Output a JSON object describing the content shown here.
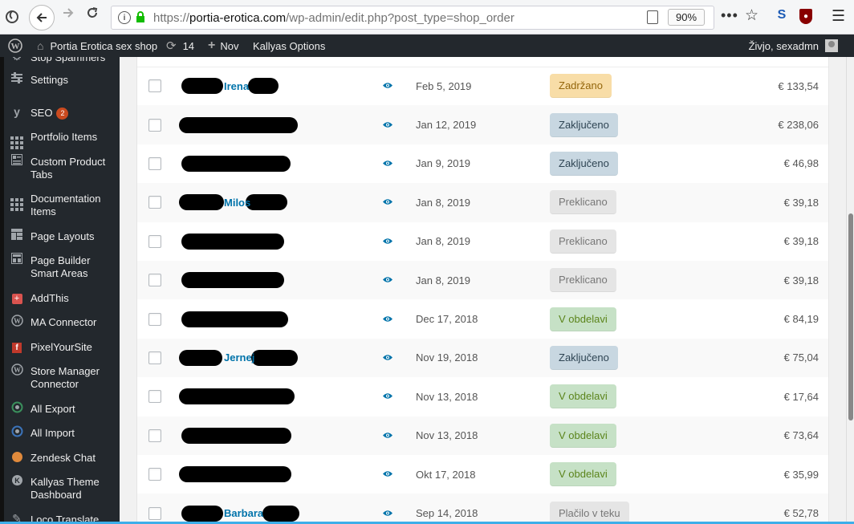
{
  "browser": {
    "url_scheme": "https://",
    "url_host": "portia-erotica.com",
    "url_path": "/wp-admin/edit.php?post_type=shop_order",
    "zoom": "90%",
    "icons": [
      "firefox-icon",
      "back-arrow-icon",
      "forward-arrow-icon",
      "reload-icon",
      "info-icon",
      "lock-icon",
      "reader-view-icon",
      "more-actions-icon",
      "bookmark-star-icon",
      "extension-s-icon",
      "ublock-icon",
      "hamburger-menu-icon"
    ]
  },
  "admin_bar": {
    "site_name": "Portia Erotica sex shop",
    "updates_count": "14",
    "new_label": "Nov",
    "theme_options": "Kallyas Options",
    "greeting": "Živjo, sexadmn"
  },
  "sidebar": {
    "partial_top_item": "Stop Spammers",
    "items": [
      {
        "label": "Settings",
        "icon": "sliders-icon"
      },
      {
        "label": "SEO",
        "icon": "yoast-icon",
        "badge": "2"
      },
      {
        "label": "Portfolio Items",
        "icon": "grid-icon"
      },
      {
        "label": "Custom Product Tabs",
        "icon": "tabs-icon"
      },
      {
        "label": "Documentation Items",
        "icon": "grid-icon"
      },
      {
        "label": "Page Layouts",
        "icon": "layout-icon"
      },
      {
        "label": "Page Builder Smart Areas",
        "icon": "builder-icon"
      },
      {
        "label": "AddThis",
        "icon": "addthis-icon"
      },
      {
        "label": "MA Connector",
        "icon": "wordpress-icon"
      },
      {
        "label": "PixelYourSite",
        "icon": "facebook-icon"
      },
      {
        "label": "Store Manager Connector",
        "icon": "wordpress-icon"
      },
      {
        "label": "All Export",
        "icon": "export-icon"
      },
      {
        "label": "All Import",
        "icon": "import-icon"
      },
      {
        "label": "Zendesk Chat",
        "icon": "chat-icon"
      },
      {
        "label": "Kallyas Theme Dashboard",
        "icon": "kallyas-icon"
      },
      {
        "label": "Loco Translate",
        "icon": "translate-icon"
      }
    ]
  },
  "orders": [
    {
      "name": "Irena",
      "date": "Feb 5, 2019",
      "status": "Zadržano",
      "status_type": "hold",
      "total": "€ 133,54"
    },
    {
      "name": "",
      "date": "Jan 12, 2019",
      "status": "Zaključeno",
      "status_type": "completed",
      "total": "€ 238,06"
    },
    {
      "name": "",
      "date": "Jan 9, 2019",
      "status": "Zaključeno",
      "status_type": "completed",
      "total": "€ 46,98"
    },
    {
      "name": "Milos",
      "date": "Jan 8, 2019",
      "status": "Preklicano",
      "status_type": "cancelled",
      "total": "€ 39,18"
    },
    {
      "name": "",
      "date": "Jan 8, 2019",
      "status": "Preklicano",
      "status_type": "cancelled",
      "total": "€ 39,18"
    },
    {
      "name": "",
      "date": "Jan 8, 2019",
      "status": "Preklicano",
      "status_type": "cancelled",
      "total": "€ 39,18"
    },
    {
      "name": "",
      "date": "Dec 17, 2018",
      "status": "V obdelavi",
      "status_type": "processing",
      "total": "€ 84,19"
    },
    {
      "name": "Jernej",
      "date": "Nov 19, 2018",
      "status": "Zaključeno",
      "status_type": "completed",
      "total": "€ 75,04"
    },
    {
      "name": "",
      "date": "Nov 13, 2018",
      "status": "V obdelavi",
      "status_type": "processing",
      "total": "€ 17,64"
    },
    {
      "name": "",
      "date": "Nov 13, 2018",
      "status": "V obdelavi",
      "status_type": "processing",
      "total": "€ 73,64"
    },
    {
      "name": "",
      "date": "Okt 17, 2018",
      "status": "V obdelavi",
      "status_type": "processing",
      "total": "€ 35,99"
    },
    {
      "name": "Barbara",
      "date": "Sep 14, 2018",
      "status": "Plačilo v teku",
      "status_type": "pending",
      "total": "€ 52,78"
    }
  ],
  "colors": {
    "admin_bg": "#23282d",
    "link": "#0073aa",
    "hold": "#f8dda7",
    "completed": "#c8d7e1",
    "cancelled": "#e5e5e5",
    "processing": "#c6e1c6"
  }
}
